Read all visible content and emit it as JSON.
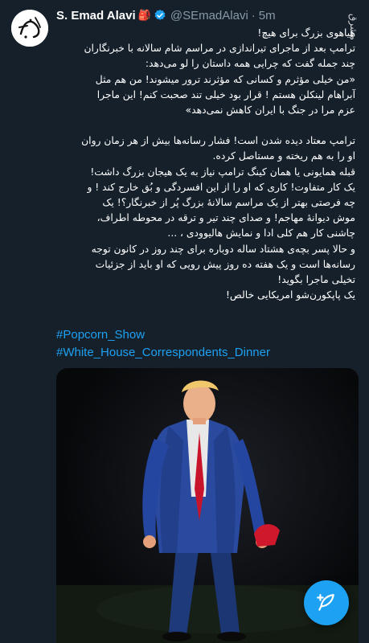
{
  "author": {
    "name": "S. Emad Alavi",
    "badge_emoji": "🎒",
    "handle": "@SEmadAlavi",
    "separator": "·",
    "time": "5m",
    "avatar_icon": "calligraphy-avatar-icon",
    "verified_color": "#1da1f2"
  },
  "tweet": {
    "lines": [
      "هیاهوی بزرگ برای هیچ!",
      "ترامپ بعد از ماجرای تیراندازی در مراسم شام سالانه با خبرنگاران",
      "چند جمله گفت که چرایی همه داستان را لو می‌دهد:",
      "«من خیلی مؤثرم و کسانی که مؤثرند ترور میشوند! من هم مثل",
      "آبراهام لینکلن هستم ! قرار بود خیلی تند صحبت کنم! این ماجرا",
      "عزم مرا در جنگ با ایران کاهش نمی‌دهد»",
      "",
      "ترامپ معتاد دیده شدن است! فشار رسانه‌ها بیش از هر زمان روان",
      "او را به هم ریخته و مستاصل کرده.",
      "قبله همایونی یا همان کینگ ترامپ نیاز به یک هیجان بزرگ داشت!",
      "یک کار متفاوت! کاری که او را از این افسردگی و بُق خارج کند !  و",
      "چه فرصتی بهتر از یک مراسم سالانهٔ بزرگ پُر از خبرنگار؟! یک",
      "موش دیوانهٔ مهاجم! و صدای چند تیر و ترقه در محوطه اطراف،",
      "چاشنی کار هم کلی ادا و نمایش هالیوودی ، ...",
      "و حالا پسر بچه‌ی هشتاد ساله دوباره برای چند روز در کانون توجه",
      "رسانه‌ها است و یک هفته ده روز پیش رویی که او باید از جزئیات",
      "تخیلی ماجرا بگوید!",
      "یک پاپکورن‌شو امریکایی خالص!"
    ],
    "hashtags": [
      "#Popcorn_Show",
      "#White_House_Correspondents_Dinner"
    ]
  },
  "watermark": "مشرق",
  "compose_button": {
    "icon": "compose-feather-icon"
  },
  "colors": {
    "background": "#15202b",
    "text": "#ffffff",
    "secondary": "#8899a6",
    "link": "#1da1f2",
    "accent": "#1da1f2"
  }
}
